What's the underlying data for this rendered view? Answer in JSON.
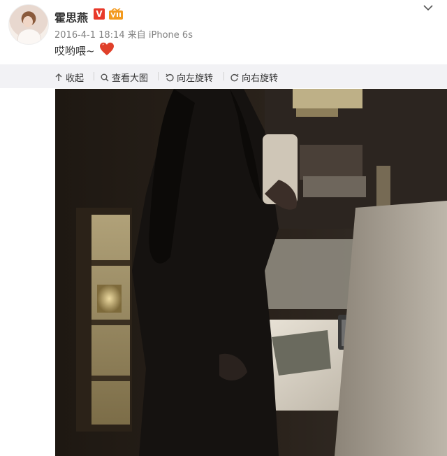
{
  "post": {
    "username": "霍思燕",
    "verified_badge": "V",
    "timestamp": "2016-4-1 18:14",
    "source_prefix": "来自",
    "source_device": "iPhone 6s",
    "text": "哎哟喂~",
    "emoji": "heart-icon"
  },
  "toolbar": {
    "collapse_label": "收起",
    "view_large_label": "查看大图",
    "rotate_left_label": "向左旋转",
    "rotate_right_label": "向右旋转"
  },
  "colors": {
    "toolbar_bg": "#f2f2f5",
    "username": "#333333",
    "meta": "#808080",
    "verified_badge": "#e8392a",
    "heart": "#e0402a"
  }
}
